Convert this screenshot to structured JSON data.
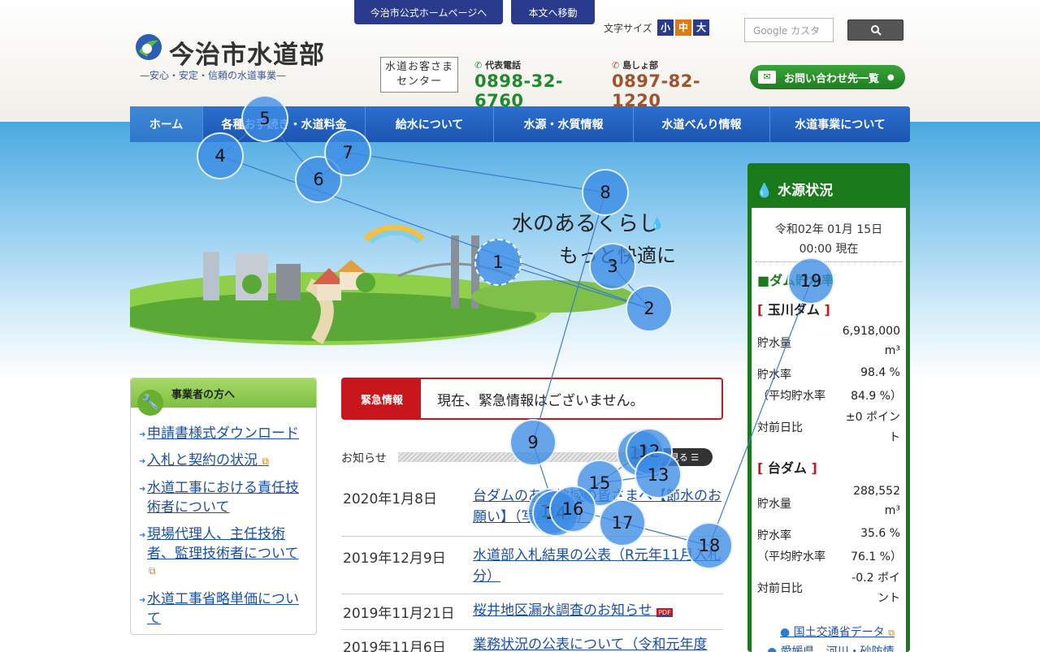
{
  "header": {
    "top_links": [
      "今治市公式ホームページへ",
      "本文へ移動"
    ],
    "logo_title": "今治市水道部",
    "logo_subtitle": "—安心・安定・信頼の水道事業—",
    "font_size_label": "文字サイズ",
    "font_sizes": [
      "小",
      "中",
      "大"
    ],
    "search_placeholder": "Google カスタ",
    "customer_center": [
      "水道お客さま",
      "センター"
    ],
    "main_phone_label": "代表電話",
    "main_phone": "0898-32-6760",
    "island_phone_label": "島しょ部",
    "island_phone": "0897-82-1220",
    "contact_button": "お問い合わせ先一覧"
  },
  "nav": [
    "ホーム",
    "各種お手続き・水道料金",
    "給水について",
    "水源・水質情報",
    "水道べんり情報",
    "水道事業について"
  ],
  "hero": {
    "line1": "水のあるくらし",
    "line2": "もっと快適に"
  },
  "business": {
    "heading": "事業者の方へ",
    "links": [
      "申請書様式ダウンロード",
      "入札と契約の状況",
      "水道工事における責任技術者について",
      "現場代理人、主任技術者、監理技術者について",
      "水道工事省略単価について"
    ]
  },
  "emergency": {
    "label": "緊急情報",
    "message": "現在、緊急情報はございません。"
  },
  "news": {
    "heading": "お知らせ",
    "more": "一覧を見る",
    "items": [
      {
        "date": "2020年1月8日",
        "title": "台ダムのある地域の皆さまへ【節水のお願い】（写真有付）"
      },
      {
        "date": "2019年12月9日",
        "title": "水道部入札結果の公表（R元年11月入札分）"
      },
      {
        "date": "2019年11月21日",
        "title": "桜井地区漏水調査のお知らせ"
      },
      {
        "date": "2019年11月6日",
        "title": "業務状況の公表について（令和元年度"
      }
    ]
  },
  "water_status": {
    "heading": "水源状況",
    "date": "令和02年 01月 15日",
    "time": "00:00 現在",
    "section": "■ダム貯水率",
    "dams": [
      {
        "name": "玉川ダム",
        "storage_label": "貯水量",
        "storage": "6,918,000",
        "unit": "m³",
        "rate_label": "貯水率",
        "rate": "98.4 %",
        "avg_label": "（平均貯水率",
        "avg": "84.9 %）",
        "diff_label": "対前日比",
        "diff": "±0 ポイン",
        "diff_tail": "ト"
      },
      {
        "name": "台ダム",
        "storage_label": "貯水量",
        "storage": "288,552",
        "unit": "m³",
        "rate_label": "貯水率",
        "rate": "35.6 %",
        "avg_label": "（平均貯水率",
        "avg": "76.1 %）",
        "diff_label": "対前日比",
        "diff": "-0.2 ポイ",
        "diff_tail": "ント"
      }
    ],
    "links": [
      "国土交通省データ",
      "愛媛県　河川・砂防情"
    ]
  },
  "markers": [
    "1",
    "2",
    "3",
    "4",
    "5",
    "6",
    "7",
    "8",
    "9",
    "10",
    "11",
    "12",
    "13",
    "14",
    "15",
    "16",
    "17",
    "18",
    "19"
  ],
  "colors": {
    "nav": "#1c55b0",
    "emergency": "#c8161d",
    "water_box": "#1a7a1a",
    "phone_main": "#1e8a2e",
    "phone_island": "#a0522d"
  }
}
